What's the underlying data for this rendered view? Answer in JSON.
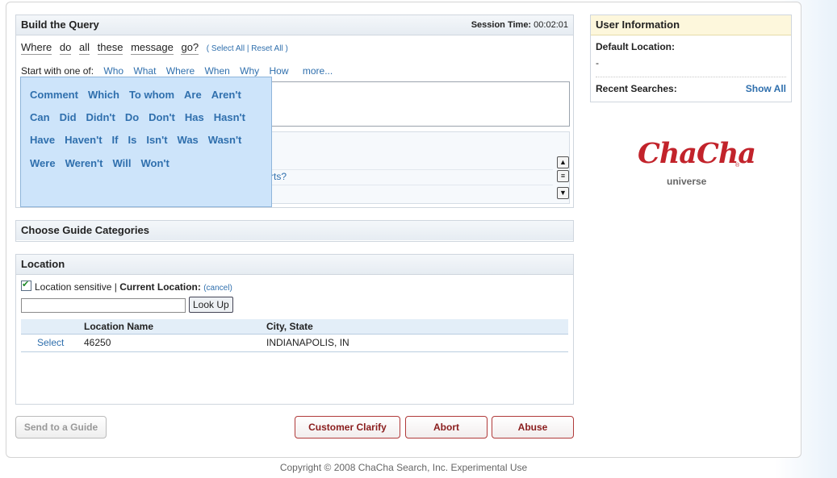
{
  "query": {
    "title": "Build the Query",
    "session_label": "Session Time:",
    "session_value": "00:02:01",
    "words": [
      "Where",
      "do",
      "all",
      "these",
      "message",
      "go?"
    ],
    "select_all": "Select All",
    "reset_all": "Reset All",
    "start_label": "Start with one of:",
    "start_words": [
      "Who",
      "What",
      "Where",
      "When",
      "Why",
      "How"
    ],
    "more": "more...",
    "partial_text": "rts?"
  },
  "popup_rows": [
    [
      "Comment",
      "Which",
      "To whom",
      "Are",
      "Aren't"
    ],
    [
      "Can",
      "Did",
      "Didn't",
      "Do",
      "Don't",
      "Has",
      "Hasn't"
    ],
    [
      "Have",
      "Haven't",
      "If",
      "Is",
      "Isn't",
      "Was",
      "Wasn't"
    ],
    [
      "Were",
      "Weren't",
      "Will",
      "Won't"
    ]
  ],
  "guide": {
    "title": "Choose Guide Categories"
  },
  "location": {
    "title": "Location",
    "sensitive_label": "Location sensitive |",
    "current_label": "Current Location:",
    "cancel": "(cancel)",
    "input_value": "",
    "lookup": "Look Up",
    "col_name": "Location Name",
    "col_city": "City, State",
    "rows": [
      {
        "action": "Select",
        "name": "46250",
        "city": "INDIANAPOLIS, IN"
      }
    ]
  },
  "buttons": {
    "send": "Send to a Guide",
    "clarify": "Customer Clarify",
    "abort": "Abort",
    "abuse": "Abuse"
  },
  "user": {
    "title": "User Information",
    "default_loc": "Default Location:",
    "default_val": "-",
    "recent": "Recent Searches:",
    "show_all": "Show All"
  },
  "logo": {
    "text": "ChaCha",
    "sub": "universe",
    "reg": "®"
  },
  "footer": "Copyright © 2008 ChaCha Search, Inc. Experimental Use",
  "colors": {
    "link": "#2f6fad",
    "brand_red": "#c2232b",
    "popup_bg": "#cde4fa"
  }
}
